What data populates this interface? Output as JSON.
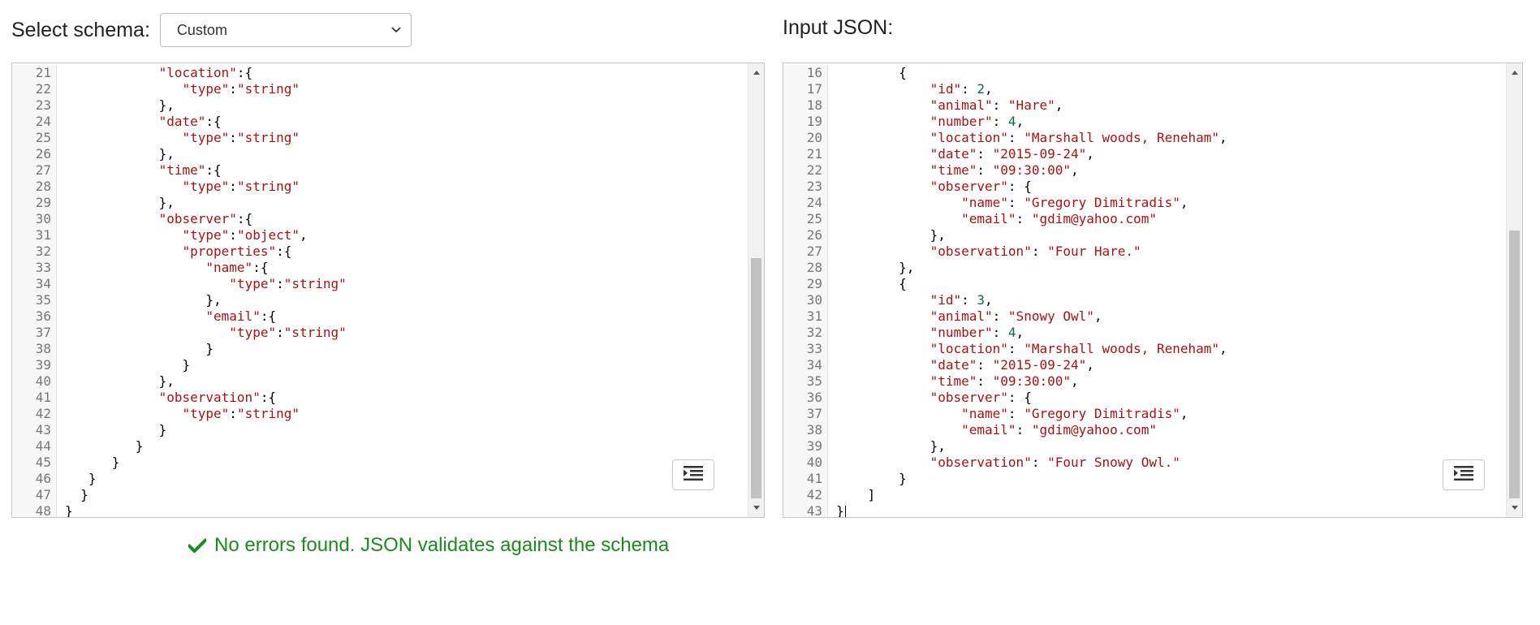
{
  "schema_panel": {
    "label": "Select schema:",
    "selected_schema": "Custom",
    "lines": [
      {
        "num": "21",
        "indent": "            ",
        "tokens": [
          [
            "key",
            "\"location\""
          ],
          [
            "punc",
            ":{"
          ]
        ]
      },
      {
        "num": "22",
        "indent": "               ",
        "tokens": [
          [
            "key",
            "\"type\""
          ],
          [
            "punc",
            ":"
          ],
          [
            "str",
            "\"string\""
          ]
        ]
      },
      {
        "num": "23",
        "indent": "            ",
        "tokens": [
          [
            "punc",
            "},"
          ]
        ]
      },
      {
        "num": "24",
        "indent": "            ",
        "tokens": [
          [
            "key",
            "\"date\""
          ],
          [
            "punc",
            ":{"
          ]
        ]
      },
      {
        "num": "25",
        "indent": "               ",
        "tokens": [
          [
            "key",
            "\"type\""
          ],
          [
            "punc",
            ":"
          ],
          [
            "str",
            "\"string\""
          ]
        ]
      },
      {
        "num": "26",
        "indent": "            ",
        "tokens": [
          [
            "punc",
            "},"
          ]
        ]
      },
      {
        "num": "27",
        "indent": "            ",
        "tokens": [
          [
            "key",
            "\"time\""
          ],
          [
            "punc",
            ":{"
          ]
        ]
      },
      {
        "num": "28",
        "indent": "               ",
        "tokens": [
          [
            "key",
            "\"type\""
          ],
          [
            "punc",
            ":"
          ],
          [
            "str",
            "\"string\""
          ]
        ]
      },
      {
        "num": "29",
        "indent": "            ",
        "tokens": [
          [
            "punc",
            "},"
          ]
        ]
      },
      {
        "num": "30",
        "indent": "            ",
        "tokens": [
          [
            "key",
            "\"observer\""
          ],
          [
            "punc",
            ":{"
          ]
        ]
      },
      {
        "num": "31",
        "indent": "               ",
        "tokens": [
          [
            "key",
            "\"type\""
          ],
          [
            "punc",
            ":"
          ],
          [
            "str",
            "\"object\""
          ],
          [
            "punc",
            ","
          ]
        ]
      },
      {
        "num": "32",
        "indent": "               ",
        "tokens": [
          [
            "key",
            "\"properties\""
          ],
          [
            "punc",
            ":{"
          ]
        ]
      },
      {
        "num": "33",
        "indent": "                  ",
        "tokens": [
          [
            "key",
            "\"name\""
          ],
          [
            "punc",
            ":{"
          ]
        ]
      },
      {
        "num": "34",
        "indent": "                     ",
        "tokens": [
          [
            "key",
            "\"type\""
          ],
          [
            "punc",
            ":"
          ],
          [
            "str",
            "\"string\""
          ]
        ]
      },
      {
        "num": "35",
        "indent": "                  ",
        "tokens": [
          [
            "punc",
            "},"
          ]
        ]
      },
      {
        "num": "36",
        "indent": "                  ",
        "tokens": [
          [
            "key",
            "\"email\""
          ],
          [
            "punc",
            ":{"
          ]
        ]
      },
      {
        "num": "37",
        "indent": "                     ",
        "tokens": [
          [
            "key",
            "\"type\""
          ],
          [
            "punc",
            ":"
          ],
          [
            "str",
            "\"string\""
          ]
        ]
      },
      {
        "num": "38",
        "indent": "                  ",
        "tokens": [
          [
            "punc",
            "}"
          ]
        ]
      },
      {
        "num": "39",
        "indent": "               ",
        "tokens": [
          [
            "punc",
            "}"
          ]
        ]
      },
      {
        "num": "40",
        "indent": "            ",
        "tokens": [
          [
            "punc",
            "},"
          ]
        ]
      },
      {
        "num": "41",
        "indent": "            ",
        "tokens": [
          [
            "key",
            "\"observation\""
          ],
          [
            "punc",
            ":{"
          ]
        ]
      },
      {
        "num": "42",
        "indent": "               ",
        "tokens": [
          [
            "key",
            "\"type\""
          ],
          [
            "punc",
            ":"
          ],
          [
            "str",
            "\"string\""
          ]
        ]
      },
      {
        "num": "43",
        "indent": "            ",
        "tokens": [
          [
            "punc",
            "}"
          ]
        ]
      },
      {
        "num": "44",
        "indent": "         ",
        "tokens": [
          [
            "punc",
            "}"
          ]
        ]
      },
      {
        "num": "45",
        "indent": "      ",
        "tokens": [
          [
            "punc",
            "}"
          ]
        ]
      },
      {
        "num": "46",
        "indent": "   ",
        "tokens": [
          [
            "punc",
            "}"
          ]
        ]
      },
      {
        "num": "47",
        "indent": "  ",
        "tokens": [
          [
            "punc",
            "}"
          ]
        ]
      },
      {
        "num": "48",
        "indent": "",
        "tokens": [
          [
            "punc",
            "}"
          ]
        ]
      }
    ]
  },
  "input_panel": {
    "label": "Input JSON:",
    "lines": [
      {
        "num": "16",
        "indent": "        ",
        "tokens": [
          [
            "punc",
            "{"
          ]
        ]
      },
      {
        "num": "17",
        "indent": "            ",
        "tokens": [
          [
            "key",
            "\"id\""
          ],
          [
            "punc",
            ": "
          ],
          [
            "num",
            "2"
          ],
          [
            "punc",
            ","
          ]
        ]
      },
      {
        "num": "18",
        "indent": "            ",
        "tokens": [
          [
            "key",
            "\"animal\""
          ],
          [
            "punc",
            ": "
          ],
          [
            "str",
            "\"Hare\""
          ],
          [
            "punc",
            ","
          ]
        ]
      },
      {
        "num": "19",
        "indent": "            ",
        "tokens": [
          [
            "key",
            "\"number\""
          ],
          [
            "punc",
            ": "
          ],
          [
            "num",
            "4"
          ],
          [
            "punc",
            ","
          ]
        ]
      },
      {
        "num": "20",
        "indent": "            ",
        "tokens": [
          [
            "key",
            "\"location\""
          ],
          [
            "punc",
            ": "
          ],
          [
            "str",
            "\"Marshall woods, Reneham\""
          ],
          [
            "punc",
            ","
          ]
        ]
      },
      {
        "num": "21",
        "indent": "            ",
        "tokens": [
          [
            "key",
            "\"date\""
          ],
          [
            "punc",
            ": "
          ],
          [
            "str",
            "\"2015-09-24\""
          ],
          [
            "punc",
            ","
          ]
        ]
      },
      {
        "num": "22",
        "indent": "            ",
        "tokens": [
          [
            "key",
            "\"time\""
          ],
          [
            "punc",
            ": "
          ],
          [
            "str",
            "\"09:30:00\""
          ],
          [
            "punc",
            ","
          ]
        ]
      },
      {
        "num": "23",
        "indent": "            ",
        "tokens": [
          [
            "key",
            "\"observer\""
          ],
          [
            "punc",
            ": {"
          ]
        ]
      },
      {
        "num": "24",
        "indent": "                ",
        "tokens": [
          [
            "key",
            "\"name\""
          ],
          [
            "punc",
            ": "
          ],
          [
            "str",
            "\"Gregory Dimitradis\""
          ],
          [
            "punc",
            ","
          ]
        ]
      },
      {
        "num": "25",
        "indent": "                ",
        "tokens": [
          [
            "key",
            "\"email\""
          ],
          [
            "punc",
            ": "
          ],
          [
            "str",
            "\"gdim@yahoo.com\""
          ]
        ]
      },
      {
        "num": "26",
        "indent": "            ",
        "tokens": [
          [
            "punc",
            "},"
          ]
        ]
      },
      {
        "num": "27",
        "indent": "            ",
        "tokens": [
          [
            "key",
            "\"observation\""
          ],
          [
            "punc",
            ": "
          ],
          [
            "str",
            "\"Four Hare.\""
          ]
        ]
      },
      {
        "num": "28",
        "indent": "        ",
        "tokens": [
          [
            "punc",
            "},"
          ]
        ]
      },
      {
        "num": "29",
        "indent": "        ",
        "tokens": [
          [
            "punc",
            "{"
          ]
        ]
      },
      {
        "num": "30",
        "indent": "            ",
        "tokens": [
          [
            "key",
            "\"id\""
          ],
          [
            "punc",
            ": "
          ],
          [
            "num",
            "3"
          ],
          [
            "punc",
            ","
          ]
        ]
      },
      {
        "num": "31",
        "indent": "            ",
        "tokens": [
          [
            "key",
            "\"animal\""
          ],
          [
            "punc",
            ": "
          ],
          [
            "str",
            "\"Snowy Owl\""
          ],
          [
            "punc",
            ","
          ]
        ]
      },
      {
        "num": "32",
        "indent": "            ",
        "tokens": [
          [
            "key",
            "\"number\""
          ],
          [
            "punc",
            ": "
          ],
          [
            "num",
            "4"
          ],
          [
            "punc",
            ","
          ]
        ]
      },
      {
        "num": "33",
        "indent": "            ",
        "tokens": [
          [
            "key",
            "\"location\""
          ],
          [
            "punc",
            ": "
          ],
          [
            "str",
            "\"Marshall woods, Reneham\""
          ],
          [
            "punc",
            ","
          ]
        ]
      },
      {
        "num": "34",
        "indent": "            ",
        "tokens": [
          [
            "key",
            "\"date\""
          ],
          [
            "punc",
            ": "
          ],
          [
            "str",
            "\"2015-09-24\""
          ],
          [
            "punc",
            ","
          ]
        ]
      },
      {
        "num": "35",
        "indent": "            ",
        "tokens": [
          [
            "key",
            "\"time\""
          ],
          [
            "punc",
            ": "
          ],
          [
            "str",
            "\"09:30:00\""
          ],
          [
            "punc",
            ","
          ]
        ]
      },
      {
        "num": "36",
        "indent": "            ",
        "tokens": [
          [
            "key",
            "\"observer\""
          ],
          [
            "punc",
            ": {"
          ]
        ]
      },
      {
        "num": "37",
        "indent": "                ",
        "tokens": [
          [
            "key",
            "\"name\""
          ],
          [
            "punc",
            ": "
          ],
          [
            "str",
            "\"Gregory Dimitradis\""
          ],
          [
            "punc",
            ","
          ]
        ]
      },
      {
        "num": "38",
        "indent": "                ",
        "tokens": [
          [
            "key",
            "\"email\""
          ],
          [
            "punc",
            ": "
          ],
          [
            "str",
            "\"gdim@yahoo.com\""
          ]
        ]
      },
      {
        "num": "39",
        "indent": "            ",
        "tokens": [
          [
            "punc",
            "},"
          ]
        ]
      },
      {
        "num": "40",
        "indent": "            ",
        "tokens": [
          [
            "key",
            "\"observation\""
          ],
          [
            "punc",
            ": "
          ],
          [
            "str",
            "\"Four Snowy Owl.\""
          ]
        ]
      },
      {
        "num": "41",
        "indent": "        ",
        "tokens": [
          [
            "punc",
            "}"
          ]
        ]
      },
      {
        "num": "42",
        "indent": "    ",
        "tokens": [
          [
            "punc",
            "]"
          ]
        ]
      },
      {
        "num": "43",
        "indent": "",
        "tokens": [
          [
            "punc",
            "}"
          ]
        ],
        "cursor": true
      }
    ]
  },
  "status": {
    "message": "No errors found. JSON validates against the schema",
    "icon": "checkmark-icon",
    "color": "#1c8a1c"
  }
}
